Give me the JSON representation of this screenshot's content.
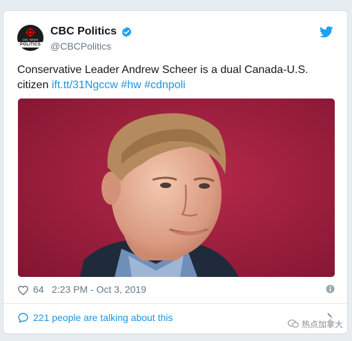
{
  "account": {
    "display_name": "CBC Politics",
    "handle": "@CBCPolitics",
    "avatar_top_text": "CBC NEWS",
    "avatar_bottom_text": "POLITICS",
    "verified": true
  },
  "tweet": {
    "text_plain": "Conservative Leader Andrew Scheer is a dual Canada-U.S. citizen",
    "link": "ift.tt/31Ngccw",
    "hashtag1": "#hw",
    "hashtag2": "#cdnpoli"
  },
  "meta": {
    "likes": "64",
    "timestamp": "2:23 PM - Oct 3, 2019"
  },
  "footer": {
    "talking": "221 people are talking about this"
  },
  "watermark": {
    "text": "热点加拿大"
  },
  "colors": {
    "link": "#1b95e0",
    "text": "#14171a",
    "muted": "#657786",
    "photo_bg": "#a21f40",
    "twitter_blue": "#1da1f2"
  },
  "icons": {
    "verified": "verified-badge-icon",
    "brand": "twitter-bird-icon",
    "like": "heart-icon",
    "info": "info-icon",
    "reply": "speech-bubble-icon",
    "chevron": "chevron-right-icon"
  }
}
